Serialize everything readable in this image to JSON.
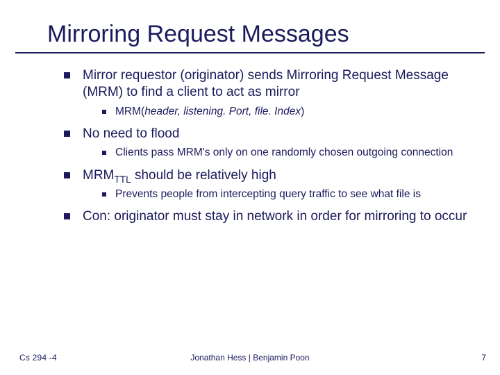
{
  "title": "Mirroring Request Messages",
  "bullets": [
    {
      "text": "Mirror requestor (originator) sends Mirroring Request Message (MRM) to find a client to act as mirror",
      "sub": [
        {
          "html": "MRM(<span class='italic'>header, listening. Port, file. Index</span>)"
        }
      ]
    },
    {
      "text": "No need to flood",
      "sub": [
        {
          "text": "Clients pass MRM's only on one randomly chosen outgoing connection"
        }
      ]
    },
    {
      "html": "MRM<sub>TTL</sub> should be relatively high",
      "sub": [
        {
          "text": "Prevents people from intercepting query traffic to see what file is"
        }
      ]
    },
    {
      "text": "Con: originator must stay in network in order for mirroring to occur"
    }
  ],
  "footer": {
    "left": "Cs 294 -4",
    "center": "Jonathan Hess | Benjamin Poon",
    "right": "7"
  }
}
